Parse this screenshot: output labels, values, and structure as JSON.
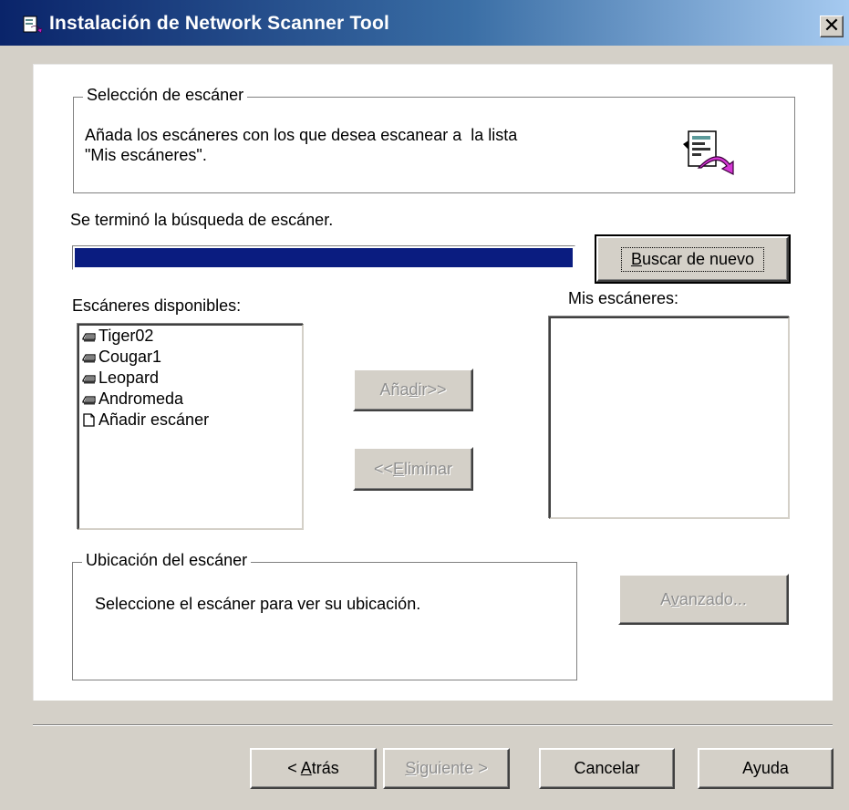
{
  "window": {
    "title": "Instalación de Network Scanner Tool",
    "close_glyph": "✕"
  },
  "scanner_selection": {
    "legend": "Selección de escáner",
    "description_line1": "Añada los escáneres con los que desea escanear a  la lista",
    "description_line2": "\"Mis escáneres\".",
    "icon": "document-scanner-icon"
  },
  "search": {
    "status": "Se terminó la búsqueda de escáner.",
    "progress": 1.0,
    "progress_color": "#0a1c80",
    "search_again_button": {
      "label": "Buscar de nuevo",
      "mnemonic": "B",
      "rest": "uscar de nuevo"
    }
  },
  "available_scanners": {
    "label": "Escáneres disponibles:",
    "items": [
      {
        "label": "Tiger02",
        "icon": "scanner-icon"
      },
      {
        "label": "Cougar1",
        "icon": "scanner-icon"
      },
      {
        "label": "Leopard",
        "icon": "scanner-icon"
      },
      {
        "label": "Andromeda",
        "icon": "scanner-icon"
      },
      {
        "label": "Añadir escáner",
        "icon": "blank-page-icon"
      }
    ]
  },
  "actions": {
    "add_button": {
      "pre": "Aña",
      "mnemonic": "d",
      "post": "ir>>"
    },
    "remove_button": {
      "pre": "<<",
      "mnemonic": "E",
      "post": "liminar"
    }
  },
  "my_scanners": {
    "label": "Mis escáneres:",
    "items": []
  },
  "scanner_location": {
    "legend": "Ubicación del escáner",
    "description": "Seleccione el escáner para ver su ubicación."
  },
  "advanced_button": {
    "pre": "A",
    "mnemonic": "v",
    "post": "anzado..."
  },
  "footer": {
    "back_button": {
      "pre": "< ",
      "mnemonic": "A",
      "post": "trás"
    },
    "next_button": {
      "pre": "",
      "mnemonic": "S",
      "post": "iguiente >"
    },
    "cancel_label": "Cancelar",
    "help_label": "Ayuda"
  },
  "colors": {
    "titlebar_start": "#0a246a",
    "titlebar_end": "#a6caf0",
    "dialog_face": "#d4d0c8",
    "disabled_text": "#8f8f8f"
  }
}
